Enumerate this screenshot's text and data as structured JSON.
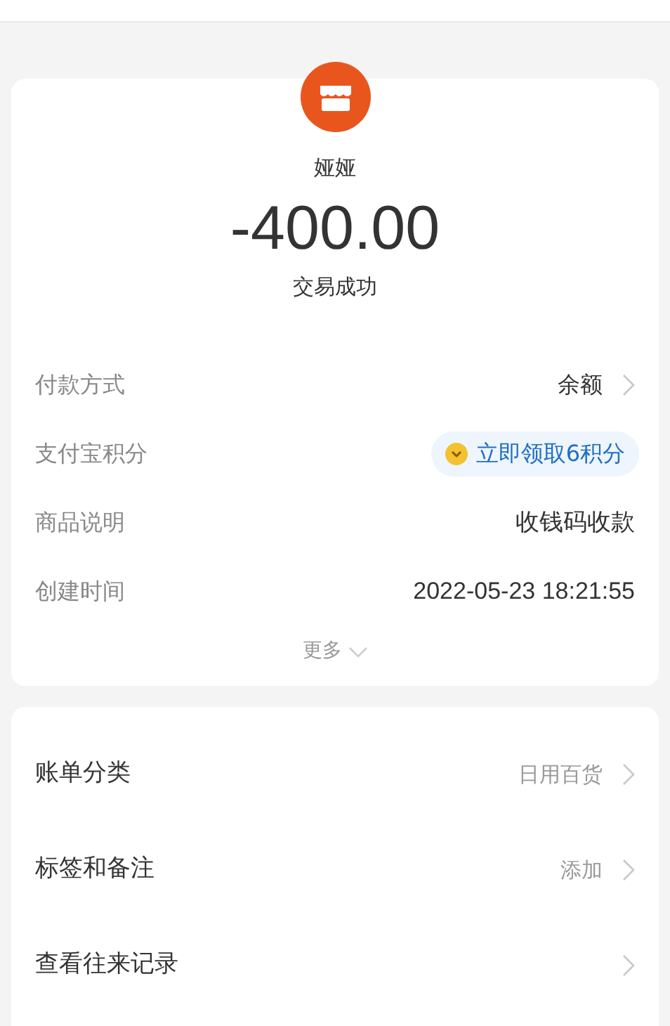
{
  "merchant": {
    "name": "娅娅",
    "amount": "-400.00",
    "status": "交易成功"
  },
  "details": [
    {
      "kind": "link",
      "label": "付款方式",
      "value": "余额"
    },
    {
      "kind": "points",
      "label": "支付宝积分",
      "value": "立即领取6积分"
    },
    {
      "kind": "plain",
      "label": "商品说明",
      "value": "收钱码收款"
    },
    {
      "kind": "plain",
      "label": "创建时间",
      "value": "2022-05-23 18:21:55"
    }
  ],
  "more": "更多",
  "actions": [
    {
      "label": "账单分类",
      "value": "日用百货"
    },
    {
      "label": "标签和备注",
      "value": "添加"
    },
    {
      "label": "查看往来记录"
    }
  ]
}
